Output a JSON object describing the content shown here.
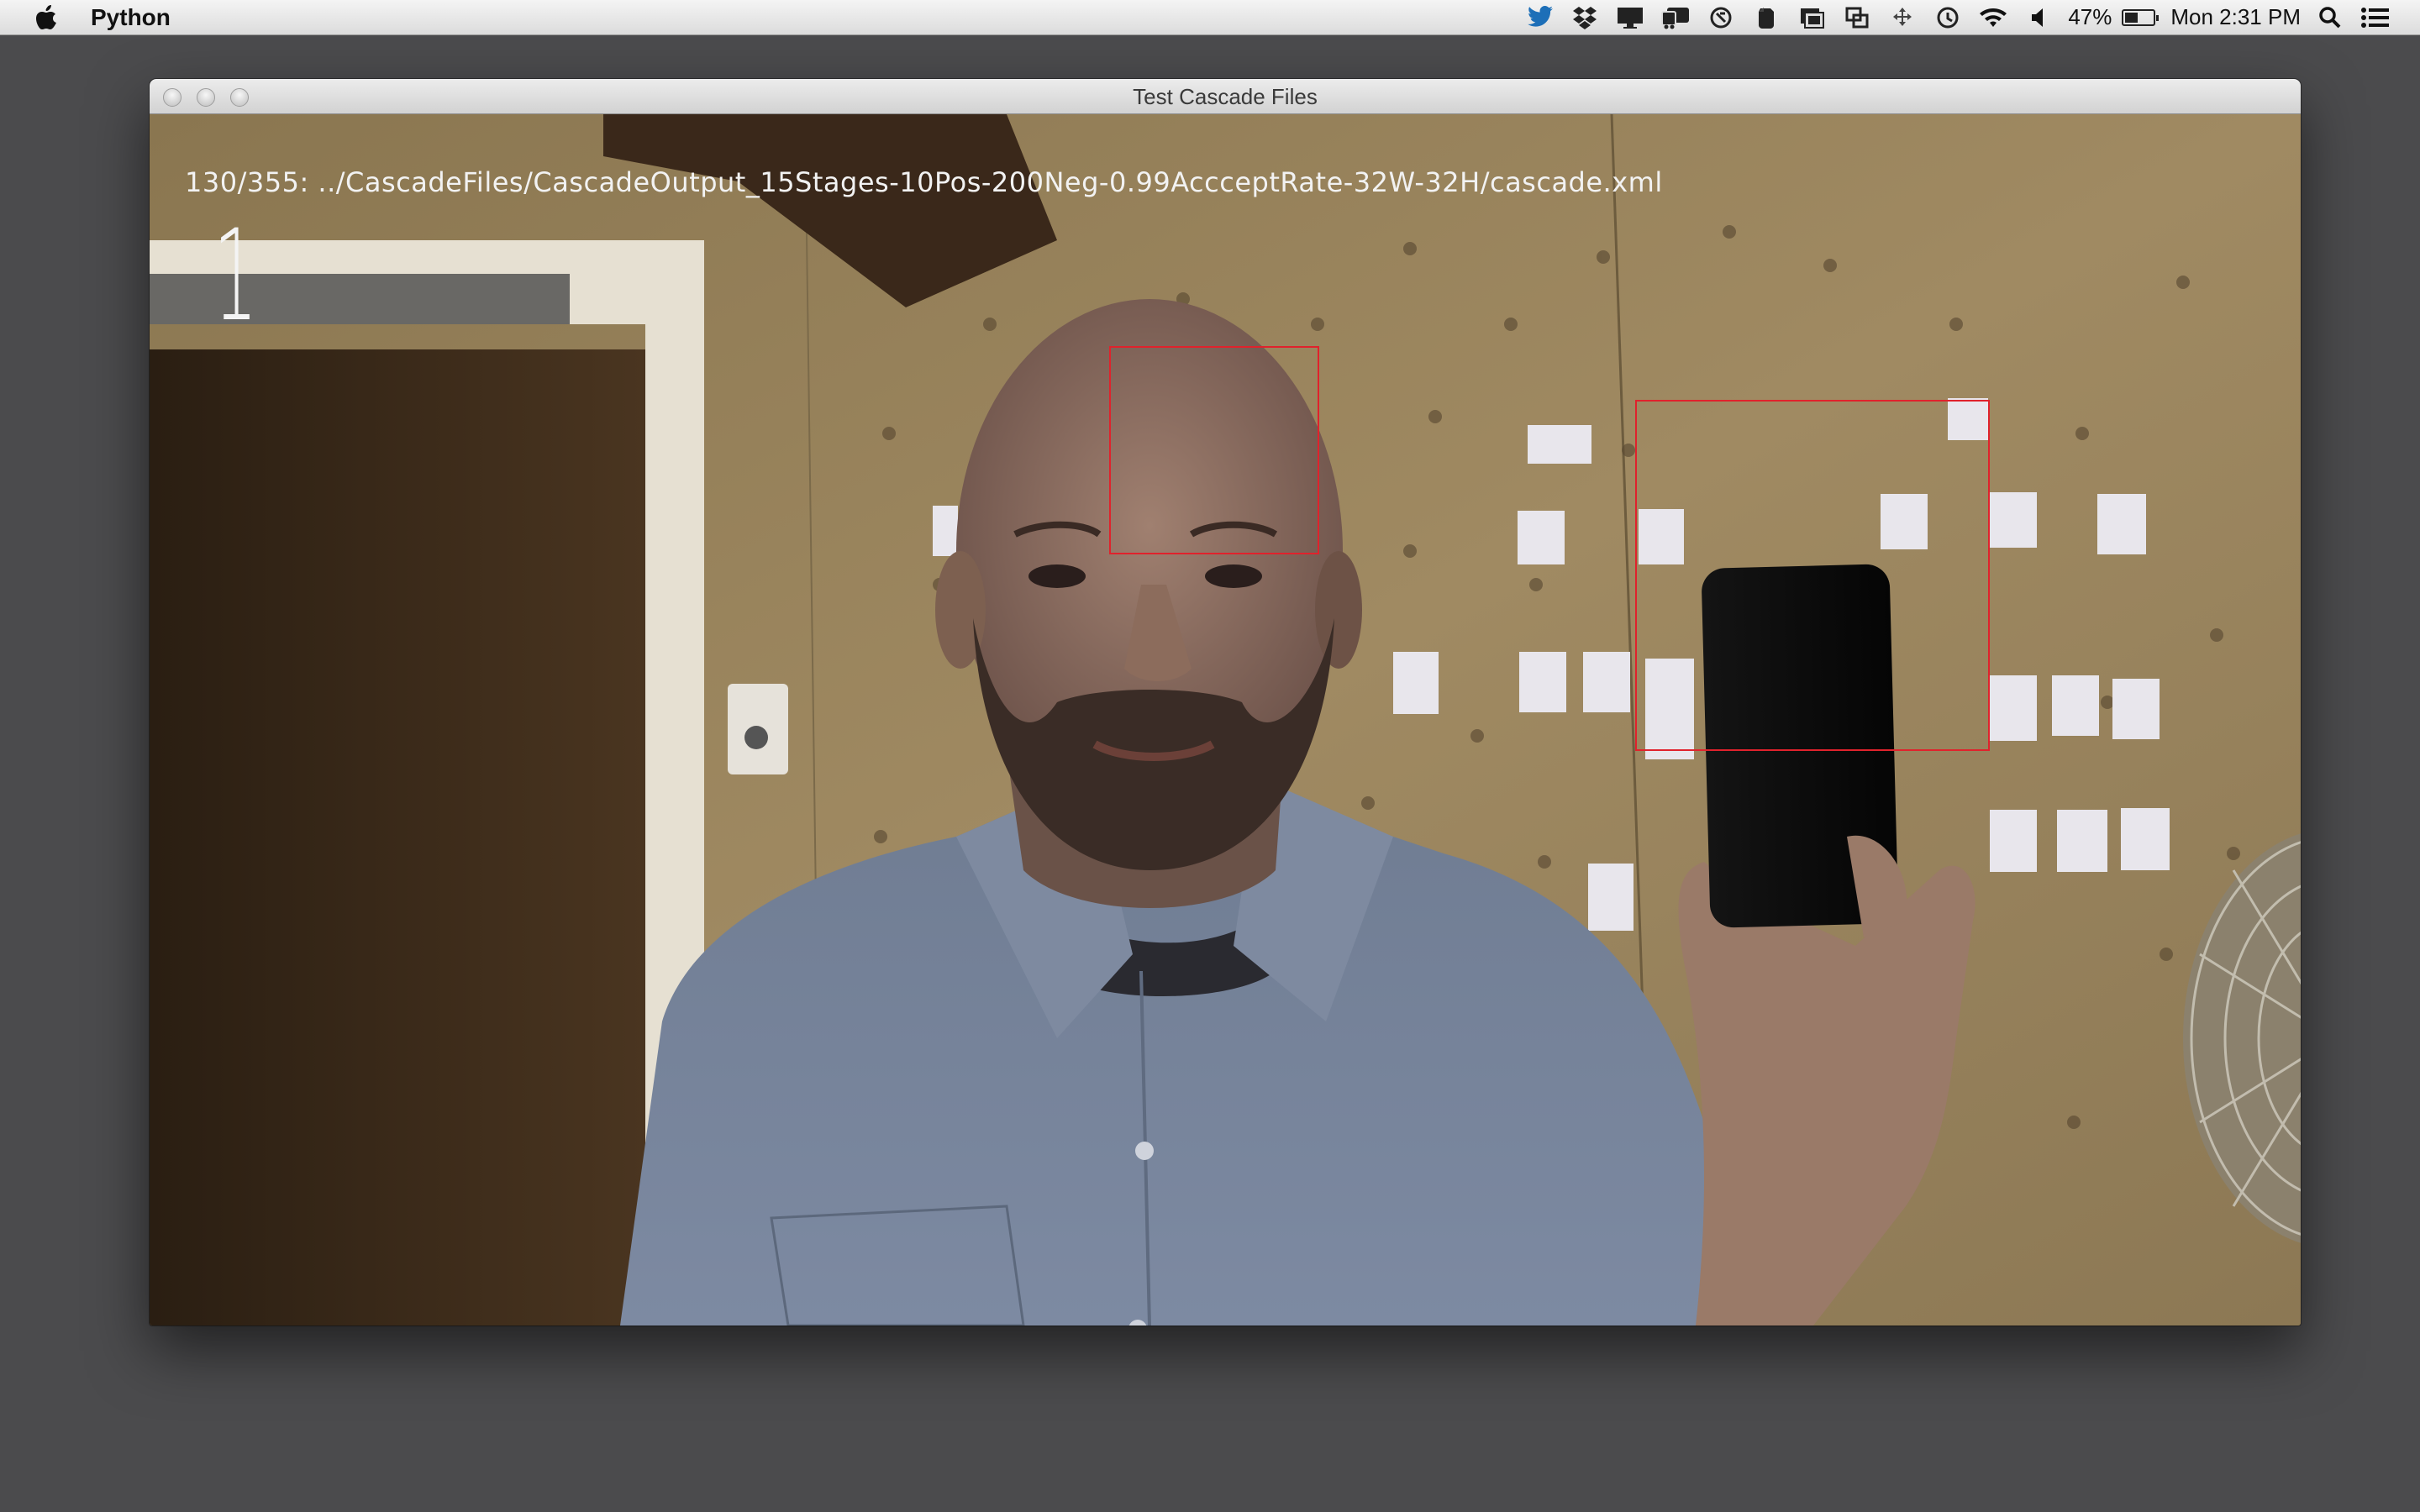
{
  "menubar": {
    "app_name": "Python",
    "battery_percent": "47%",
    "battery_level": 0.47,
    "clock": "Mon 2:31 PM",
    "icons": [
      "apple-icon",
      "twitter-icon",
      "dropbox-icon",
      "display-icon",
      "bus-icon",
      "sync-icon",
      "evernote-icon",
      "screen-icon",
      "resize-icon",
      "move-icon",
      "time-machine-icon",
      "wifi-icon",
      "volume-icon",
      "battery-icon",
      "spotlight-icon",
      "notification-center-icon"
    ]
  },
  "window": {
    "title": "Test Cascade Files"
  },
  "overlay": {
    "cascade_info": "130/355: ../CascadeFiles/CascadeOutput_15Stages-10Pos-200Neg-0.99AccceptRate-32W-32H/cascade.xml",
    "detection_count": "1"
  },
  "colors": {
    "detection_box": "#e0222c",
    "menubar": "#e8e8e8",
    "desktop": "#4b4b4d"
  }
}
